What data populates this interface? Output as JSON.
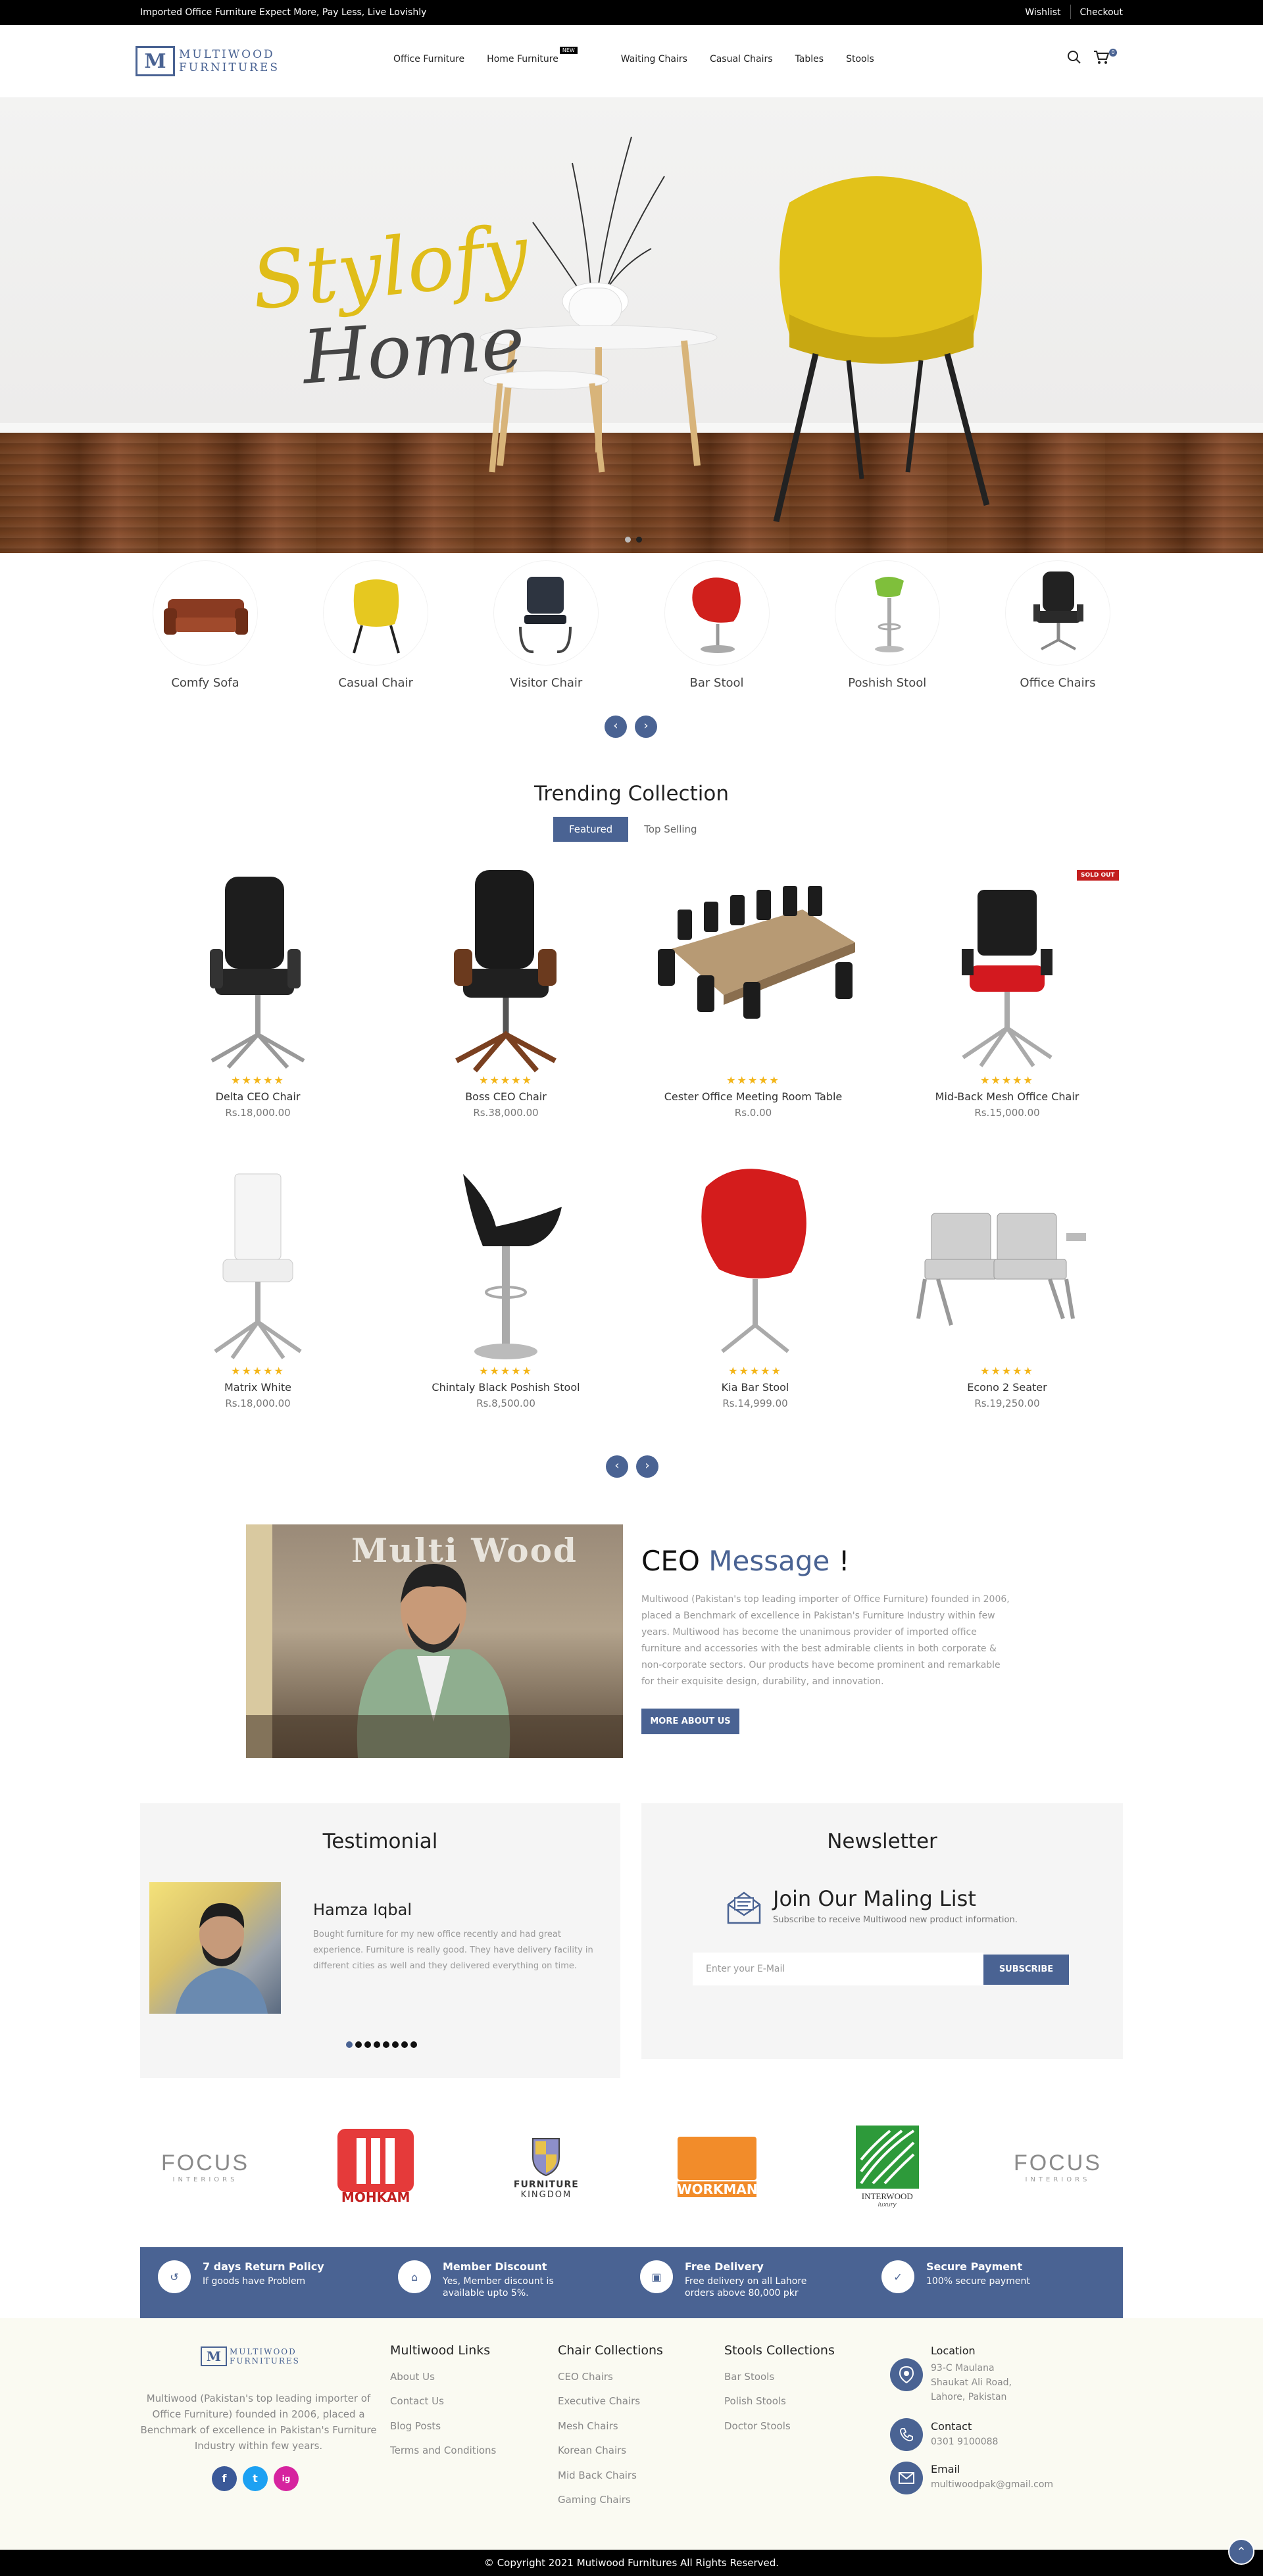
{
  "topbar": {
    "promo": "Imported Office Furniture Expect More, Pay Less, Live Lovishly",
    "wishlist": "Wishlist",
    "checkout": "Checkout"
  },
  "header": {
    "logo_mark": "M",
    "logo_line1": "MULTIWOOD",
    "logo_line2": "FURNITURES",
    "nav": [
      "Office Furniture",
      "Home Furniture",
      "Waiting Chairs",
      "Casual Chairs",
      "Tables",
      "Stools"
    ],
    "new_badge": "NEW",
    "cart_count": "0"
  },
  "hero": {
    "script1": "Stylofy",
    "script2": "Home"
  },
  "categories": [
    "Comfy Sofa",
    "Casual Chair",
    "Visitor Chair",
    "Bar Stool",
    "Poshish Stool",
    "Office Chairs"
  ],
  "trending": {
    "title": "Trending Collection",
    "tabs": [
      "Featured",
      "Top Selling"
    ],
    "sold_out": "SOLD OUT",
    "stars": "★★★★★",
    "products": [
      {
        "name": "Delta CEO Chair",
        "price": "Rs.18,000.00"
      },
      {
        "name": "Boss CEO Chair",
        "price": "Rs.38,000.00"
      },
      {
        "name": "Cester Office Meeting Room Table",
        "price": "Rs.0.00"
      },
      {
        "name": "Mid-Back Mesh Office Chair",
        "price": "Rs.15,000.00"
      },
      {
        "name": "Matrix White",
        "price": "Rs.18,000.00"
      },
      {
        "name": "Chintaly Black Poshish Stool",
        "price": "Rs.8,500.00"
      },
      {
        "name": "Kia Bar Stool",
        "price": "Rs.14,999.00"
      },
      {
        "name": "Econo 2 Seater",
        "price": "Rs.19,250.00"
      }
    ]
  },
  "ceo": {
    "wall_text": "Multi Wood",
    "title_a": "CEO",
    "title_b": "Message",
    "title_c": "!",
    "text": "Multiwood (Pakistan's top leading importer of Office Furniture) founded in 2006, placed a Benchmark of excellence in Pakistan's Furniture Industry within few years. Multiwood has become the unanimous provider of imported office furniture and accessories with the best admirable clients in both corporate & non-corporate sectors. Our products have become prominent and remarkable for their exquisite design, durability, and innovation.",
    "button": "MORE ABOUT US"
  },
  "testimonial": {
    "title": "Testimonial",
    "name": "Hamza Iqbal",
    "text": "Bought furniture for my new office recently and had great experience. Furniture is really good. They have delivery facility in different cities as well and they delivered everything on time."
  },
  "newsletter": {
    "title": "Newsletter",
    "heading": "Join Our Maling List",
    "sub": "Subscribe to receive Multiwood new product information.",
    "placeholder": "Enter your E-Mail",
    "button": "SUBSCRIBE"
  },
  "brands": [
    {
      "line1": "FOCUS",
      "line2": "INTERIORS"
    },
    {
      "line1": "MOHKAM"
    },
    {
      "line1": "FURNITURE",
      "line2": "KINGDOM"
    },
    {
      "line1": "WORKMAN"
    },
    {
      "line1": "INTERWOOD",
      "line2": "luxury"
    },
    {
      "line1": "FOCUS",
      "line2": "INTERIORS"
    }
  ],
  "features": [
    {
      "title": "7 days Return Policy",
      "text": "If goods have Problem"
    },
    {
      "title": "Member Discount",
      "text": "Yes, Member discount is available upto 5%."
    },
    {
      "title": "Free Delivery",
      "text": "Free delivery on all Lahore orders above 80,000 pkr"
    },
    {
      "title": "Secure Payment",
      "text": "100% secure payment"
    }
  ],
  "footer": {
    "about": "Multiwood (Pakistan's top leading importer of Office Furniture) founded in 2006, placed a Benchmark of excellence in Pakistan's Furniture Industry within few years.",
    "links_title": "Multiwood Links",
    "links": [
      "About Us",
      "Contact Us",
      "Blog Posts",
      "Terms and Conditions"
    ],
    "chairs_title": "Chair Collections",
    "chairs": [
      "CEO Chairs",
      "Executive Chairs",
      "Mesh Chairs",
      "Korean Chairs",
      "Mid Back Chairs",
      "Gaming Chairs"
    ],
    "stools_title": "Stools Collections",
    "stools": [
      "Bar Stools",
      "Polish Stools",
      "Doctor Stools"
    ],
    "location_title": "Location",
    "location": "93-C Maulana Shaukat Ali Road, Lahore, Pakistan",
    "contact_title": "Contact",
    "contact": "0301 9100088",
    "email_title": "Email",
    "email": "multiwoodpak@gmail.com",
    "social": [
      "f",
      "t",
      "ig"
    ]
  },
  "copyright": "© Copyright 2021 Mutiwood Furnitures All Rights Reserved.",
  "colors": {
    "accent": "#4a6393",
    "gold": "#e0bd19",
    "star": "#f3b518",
    "soldout": "#c31e1e"
  }
}
